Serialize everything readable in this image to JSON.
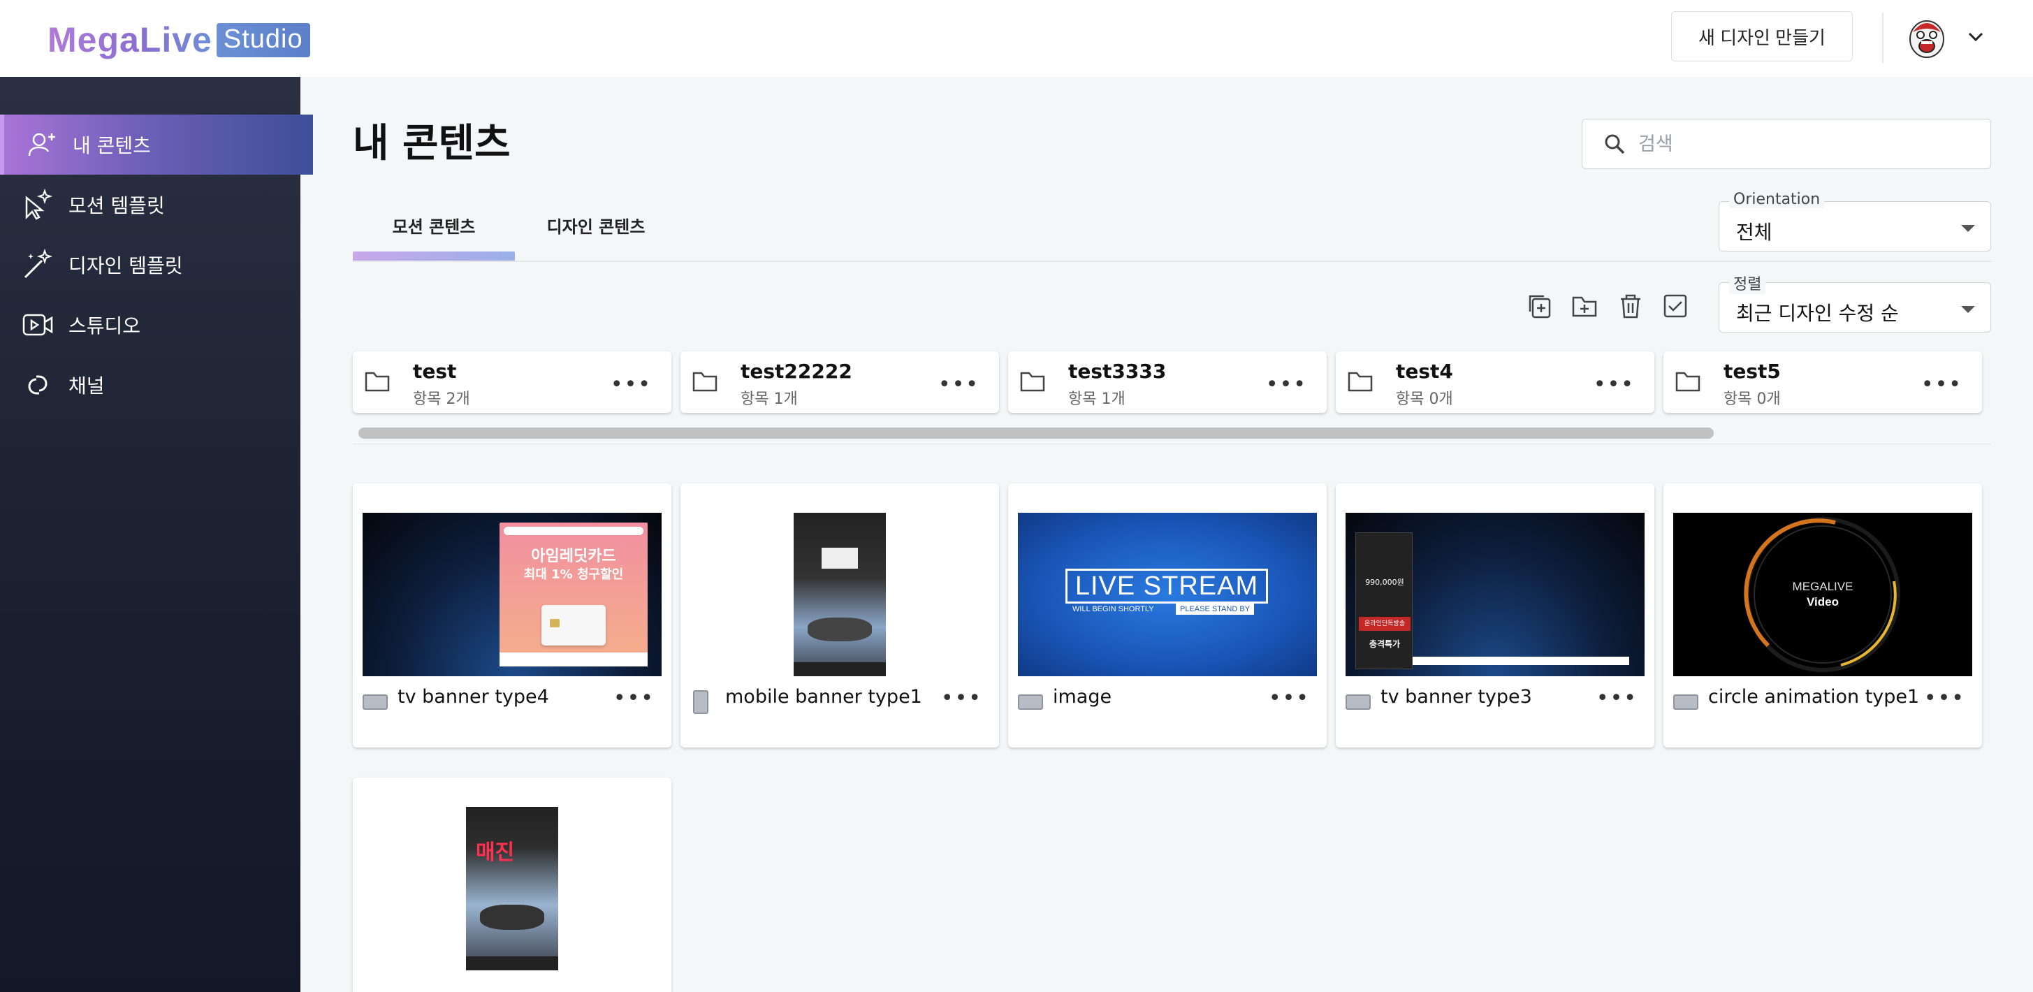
{
  "header": {
    "logo_main": "MegaLive",
    "logo_badge": "Studio",
    "new_design_label": "새 디자인 만들기"
  },
  "sidebar": {
    "items": [
      {
        "label": "내 콘텐츠",
        "icon": "user-plus-icon",
        "active": true
      },
      {
        "label": "모션 템플릿",
        "icon": "magic-pointer-icon",
        "active": false
      },
      {
        "label": "디자인 템플릿",
        "icon": "magic-wand-icon",
        "active": false
      },
      {
        "label": "스튜디오",
        "icon": "video-camera-icon",
        "active": false
      },
      {
        "label": "채널",
        "icon": "link-icon",
        "active": false
      }
    ]
  },
  "main": {
    "title": "내 콘텐츠",
    "search": {
      "placeholder": "검색"
    },
    "tabs": [
      {
        "label": "모션 콘텐츠",
        "active": true
      },
      {
        "label": "디자인 콘텐츠",
        "active": false
      }
    ],
    "orientation": {
      "label": "Orientation",
      "value": "전체"
    },
    "sort": {
      "label": "정렬",
      "value": "최근 디자인 수정 순"
    },
    "folders": [
      {
        "name": "test",
        "count": "항목 2개"
      },
      {
        "name": "test22222",
        "count": "항목 1개"
      },
      {
        "name": "test3333",
        "count": "항목 1개"
      },
      {
        "name": "test4",
        "count": "항목 0개"
      },
      {
        "name": "test5",
        "count": "항목 0개"
      }
    ],
    "contents": [
      {
        "name": "tv banner type4",
        "orientation": "landscape"
      },
      {
        "name": "mobile banner type1",
        "orientation": "portrait"
      },
      {
        "name": "image",
        "orientation": "landscape"
      },
      {
        "name": "tv banner type3",
        "orientation": "landscape"
      },
      {
        "name": "circle animation type1",
        "orientation": "landscape"
      },
      {
        "name": "",
        "orientation": "portrait"
      }
    ],
    "thumbs": {
      "card_title": "아임레딧카드",
      "card_sub": "최대 1% 청구할인",
      "live_stream": "LIVE STREAM",
      "will_begin": "WILL BEGIN SHORTLY",
      "stand_by": "PLEASE STAND BY",
      "price": "990,000원",
      "promo1": "온라인단독방송",
      "promo2": "충격특가",
      "circle_line1": "MEGALIVE",
      "circle_line2": "Video",
      "sold_out": "매진"
    }
  },
  "colors": {
    "accent_purple": "#a874d8",
    "sidebar_bg": "#1a1f2e",
    "logo_blue": "#5b7fc9"
  }
}
